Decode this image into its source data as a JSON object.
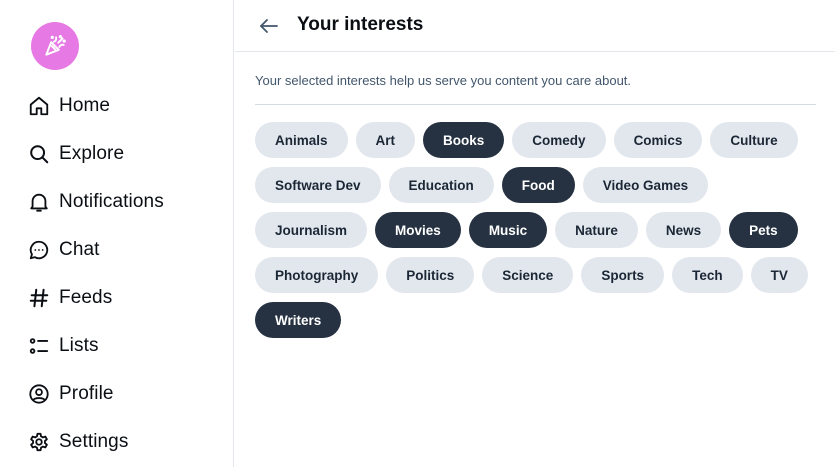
{
  "sidebar": {
    "items": [
      {
        "label": "Home",
        "icon": "home-icon"
      },
      {
        "label": "Explore",
        "icon": "search-icon"
      },
      {
        "label": "Notifications",
        "icon": "bell-icon"
      },
      {
        "label": "Chat",
        "icon": "chat-icon"
      },
      {
        "label": "Feeds",
        "icon": "hash-icon"
      },
      {
        "label": "Lists",
        "icon": "list-icon"
      },
      {
        "label": "Profile",
        "icon": "user-circle-icon"
      },
      {
        "label": "Settings",
        "icon": "gear-icon"
      }
    ]
  },
  "header": {
    "title": "Your interests"
  },
  "main": {
    "subtitle": "Your selected interests help us serve you content you care about.",
    "interests": [
      {
        "label": "Animals",
        "selected": false
      },
      {
        "label": "Art",
        "selected": false
      },
      {
        "label": "Books",
        "selected": true
      },
      {
        "label": "Comedy",
        "selected": false
      },
      {
        "label": "Comics",
        "selected": false
      },
      {
        "label": "Culture",
        "selected": false
      },
      {
        "label": "Software Dev",
        "selected": false
      },
      {
        "label": "Education",
        "selected": false
      },
      {
        "label": "Food",
        "selected": true
      },
      {
        "label": "Video Games",
        "selected": false
      },
      {
        "label": "Journalism",
        "selected": false
      },
      {
        "label": "Movies",
        "selected": true
      },
      {
        "label": "Music",
        "selected": true
      },
      {
        "label": "Nature",
        "selected": false
      },
      {
        "label": "News",
        "selected": false
      },
      {
        "label": "Pets",
        "selected": true
      },
      {
        "label": "Photography",
        "selected": false
      },
      {
        "label": "Politics",
        "selected": false
      },
      {
        "label": "Science",
        "selected": false
      },
      {
        "label": "Sports",
        "selected": false
      },
      {
        "label": "Tech",
        "selected": false
      },
      {
        "label": "TV",
        "selected": false
      },
      {
        "label": "Writers",
        "selected": true
      }
    ]
  },
  "colors": {
    "avatar_bg": "#e679e3",
    "chip_bg": "#e2e7ee",
    "chip_selected_bg": "#263241"
  }
}
